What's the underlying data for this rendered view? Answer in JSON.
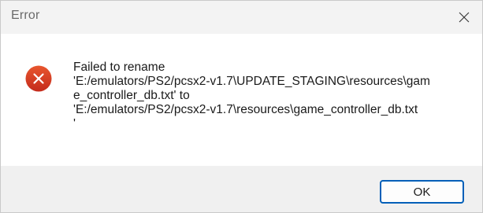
{
  "window": {
    "title": "Error"
  },
  "icons": {
    "close": "close-icon",
    "error": "error-icon",
    "error_color": "#c42b1c"
  },
  "message": {
    "lines": [
      "Failed to rename",
      "'E:/emulators/PS2/pcsx2-v1.7\\UPDATE_STAGING\\resources\\gam",
      "e_controller_db.txt' to",
      "'E:/emulators/PS2/pcsx2-v1.7\\resources\\game_controller_db.txt",
      "'"
    ]
  },
  "buttons": {
    "ok_label": "OK"
  }
}
